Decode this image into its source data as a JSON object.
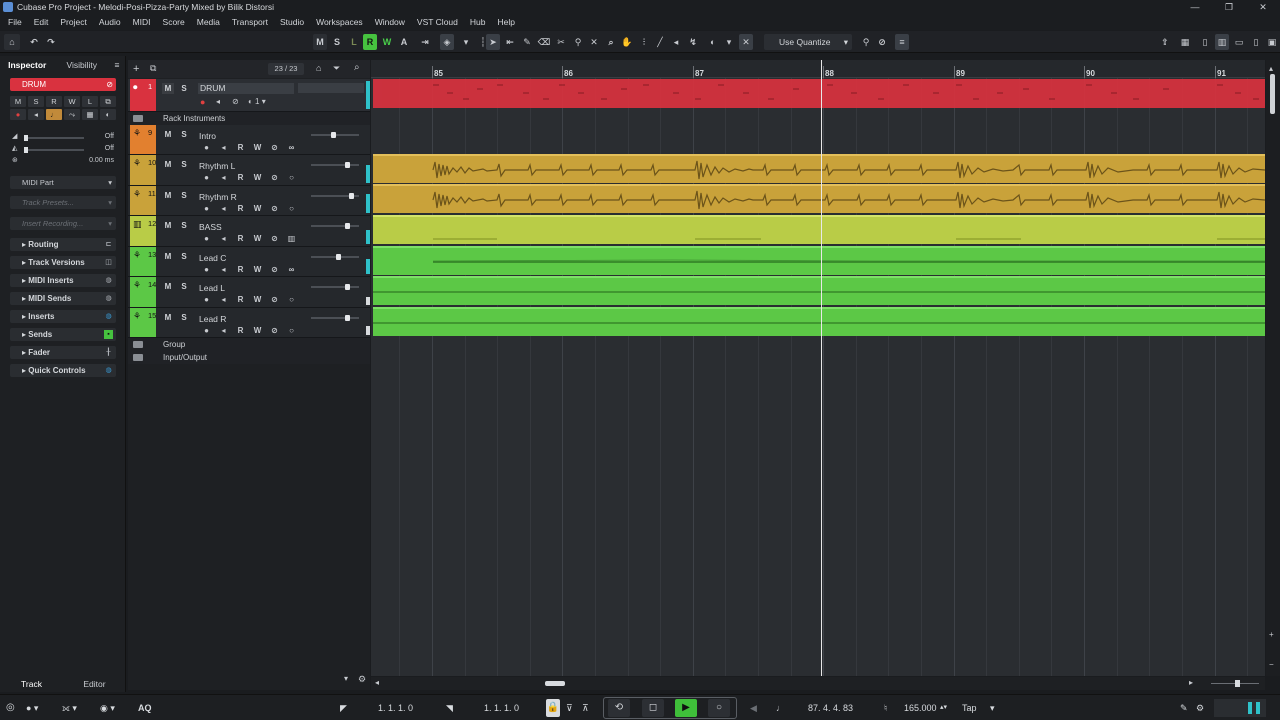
{
  "window": {
    "title": "Cubase Pro Project - Melodi-Posi-Pizza-Party Mixed by Bilik Distorsi"
  },
  "menu": [
    "File",
    "Edit",
    "Project",
    "Audio",
    "MIDI",
    "Score",
    "Media",
    "Transport",
    "Studio",
    "Workspaces",
    "Window",
    "VST Cloud",
    "Hub",
    "Help"
  ],
  "toolbar": {
    "quantize": "Use Quantize"
  },
  "inspector": {
    "tab_inspector": "Inspector",
    "tab_visibility": "Visibility",
    "track_name": "DRUM",
    "vol_off": "Off",
    "pan_off": "Off",
    "delay": "0.00 ms",
    "midi_part": "MIDI Part",
    "track_presets": "Track Presets...",
    "insert_recording": "Insert Recording...",
    "sections": [
      "Routing",
      "Track Versions",
      "MIDI Inserts",
      "MIDI Sends",
      "Inserts",
      "Sends",
      "Fader",
      "Quick Controls"
    ],
    "bottom_track": "Track",
    "bottom_editor": "Editor"
  },
  "tracklist": {
    "count": "23 / 23",
    "drum": {
      "num": "1",
      "name": "DRUM"
    },
    "rack_folder": "Rack Instruments",
    "tracks": [
      {
        "num": "9",
        "name": "Intro"
      },
      {
        "num": "10",
        "name": "Rhythm L"
      },
      {
        "num": "11",
        "name": "Rhythm R"
      },
      {
        "num": "12",
        "name": "BASS"
      },
      {
        "num": "13",
        "name": "Lead C"
      },
      {
        "num": "14",
        "name": "Lead L"
      },
      {
        "num": "15",
        "name": "Lead R"
      }
    ],
    "group_folder": "Group",
    "io_folder": "Input/Output"
  },
  "ruler": {
    "bars": [
      "85",
      "86",
      "87",
      "88",
      "89",
      "90",
      "91"
    ]
  },
  "transport": {
    "left_locator": "1. 1. 1.  0",
    "right_locator": "1. 1. 1.  0",
    "position": "87. 4. 4. 83",
    "tempo": "165.000",
    "tap": "Tap",
    "aq": "AQ"
  },
  "colors": {
    "drum": "#d9323f",
    "intro": "#e2802f",
    "rhythm": "#c9a23a",
    "bass": "#b9cc47",
    "lead": "#5cc846",
    "play": "#3fbf3a",
    "rec_active": "#46c23f"
  }
}
